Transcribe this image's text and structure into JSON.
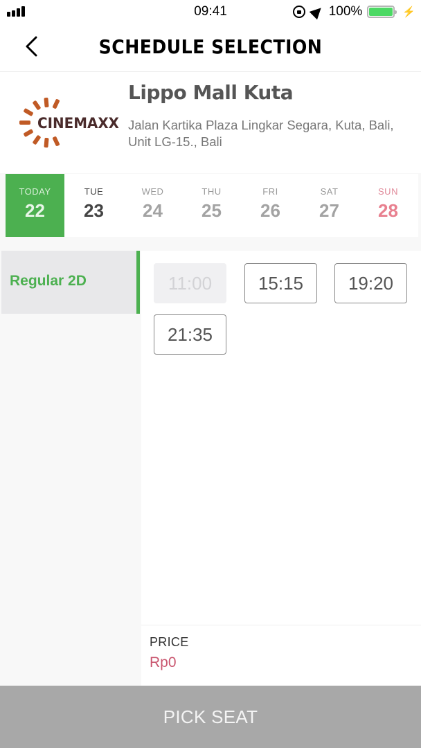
{
  "status_bar": {
    "time": "09:41",
    "battery_percent": "100%",
    "battery_level": 1.0,
    "icons": [
      "signal-icon",
      "rotation-lock-icon",
      "location-arrow-icon",
      "battery-icon",
      "charging-bolt-icon"
    ]
  },
  "header": {
    "title": "SCHEDULE SELECTION",
    "back_icon": "chevron-left-icon"
  },
  "cinema": {
    "brand": "CINEMAXX",
    "name": "Lippo Mall Kuta",
    "address": "Jalan Kartika Plaza Lingkar Segara, Kuta, Bali, Unit LG-15., Bali",
    "brand_color": "#c05a25"
  },
  "dates": [
    {
      "dow": "TODAY",
      "day": "22",
      "state": "selected"
    },
    {
      "dow": "TUE",
      "day": "23",
      "state": "available"
    },
    {
      "dow": "WED",
      "day": "24",
      "state": "unavailable"
    },
    {
      "dow": "THU",
      "day": "25",
      "state": "unavailable"
    },
    {
      "dow": "FRI",
      "day": "26",
      "state": "unavailable"
    },
    {
      "dow": "SAT",
      "day": "27",
      "state": "unavailable"
    },
    {
      "dow": "SUN",
      "day": "28",
      "state": "weekend"
    }
  ],
  "formats": [
    {
      "label": "Regular 2D",
      "selected": true
    }
  ],
  "showtimes": [
    {
      "time": "11:00",
      "enabled": false
    },
    {
      "time": "15:15",
      "enabled": true
    },
    {
      "time": "19:20",
      "enabled": true
    },
    {
      "time": "21:35",
      "enabled": true
    }
  ],
  "price": {
    "label": "PRICE",
    "value": "Rp0"
  },
  "actions": {
    "pick_seat_label": "PICK SEAT"
  },
  "colors": {
    "accent_green": "#4cb050",
    "sunday_red": "#e8808f",
    "price_pink": "#c9566f",
    "disabled_button": "#a8a8a8"
  }
}
